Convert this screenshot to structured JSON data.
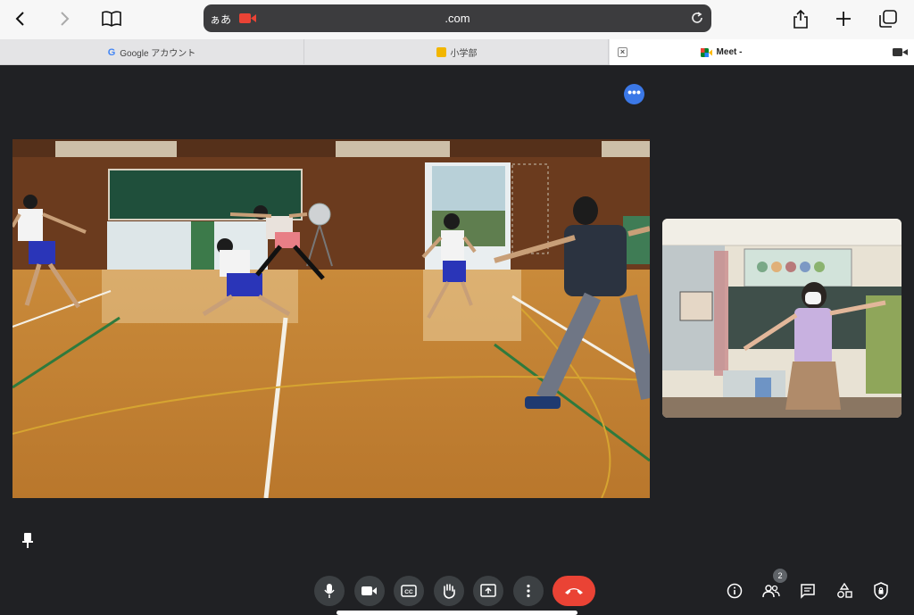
{
  "browser": {
    "address_prefix": "ぁあ",
    "url": ".com",
    "tabs": [
      {
        "label": "Google アカウント"
      },
      {
        "label": "小学部"
      },
      {
        "label": "Meet -"
      }
    ]
  },
  "meet": {
    "participants_count": "2",
    "main_tile": {
      "content": "gym-video"
    },
    "side_tile": {
      "content": "classroom-video"
    }
  },
  "colors": {
    "meet_bg": "#202124",
    "control_bg": "#3c4043",
    "hangup": "#ea4335",
    "accent_blue": "#3b78e7"
  }
}
